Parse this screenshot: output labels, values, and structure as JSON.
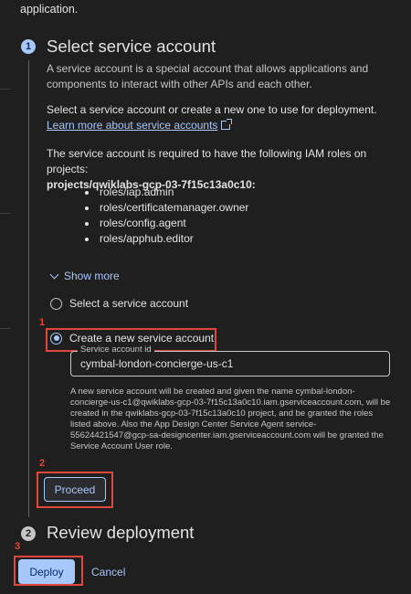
{
  "top_text": "application.",
  "step1": {
    "number": "1",
    "title": "Select service account",
    "description": "A service account is a special account that allows applications and components to interact with other APIs and each other.",
    "select_prefix": "Select a service account or create a new one to use for deployment.",
    "learn_more_link": "Learn more about service accounts",
    "iam_intro": "The service account is required to have the following IAM roles on projects:",
    "iam_project": "projects/qwiklabs-gcp-03-7f15c13a0c10:",
    "roles": [
      "roles/iap.admin",
      "roles/certificatemanager.owner",
      "roles/config.agent",
      "roles/apphub.editor"
    ],
    "show_more": "Show more",
    "radio_select_label": "Select a service account",
    "radio_create_label": "Create a new service account",
    "service_account_id_label": "Service account id",
    "service_account_id_value": "cymbal-london-concierge-us-c1",
    "note": "A new service account will be created and given the name cymbal-london-concierge-us-c1@qwiklabs-gcp-03-7f15c13a0c10.iam.gserviceaccount.com, will be created in the qwiklabs-gcp-03-7f15c13a0c10 project, and be granted the roles listed above. Also the App Design Center Service Agent service-55624421547@gcp-sa-designcenter.iam.gserviceaccount.com will be granted the Service Account User role.",
    "proceed_button": "Proceed"
  },
  "step2": {
    "number": "2",
    "title": "Review deployment"
  },
  "footer": {
    "deploy_button": "Deploy",
    "cancel_button": "Cancel"
  },
  "annotations": {
    "marker1": "1",
    "marker2": "2",
    "marker3": "3"
  },
  "colors": {
    "accent": "#a8c7fa",
    "annotation_red": "#e0463c",
    "background": "#1f1f1f"
  }
}
